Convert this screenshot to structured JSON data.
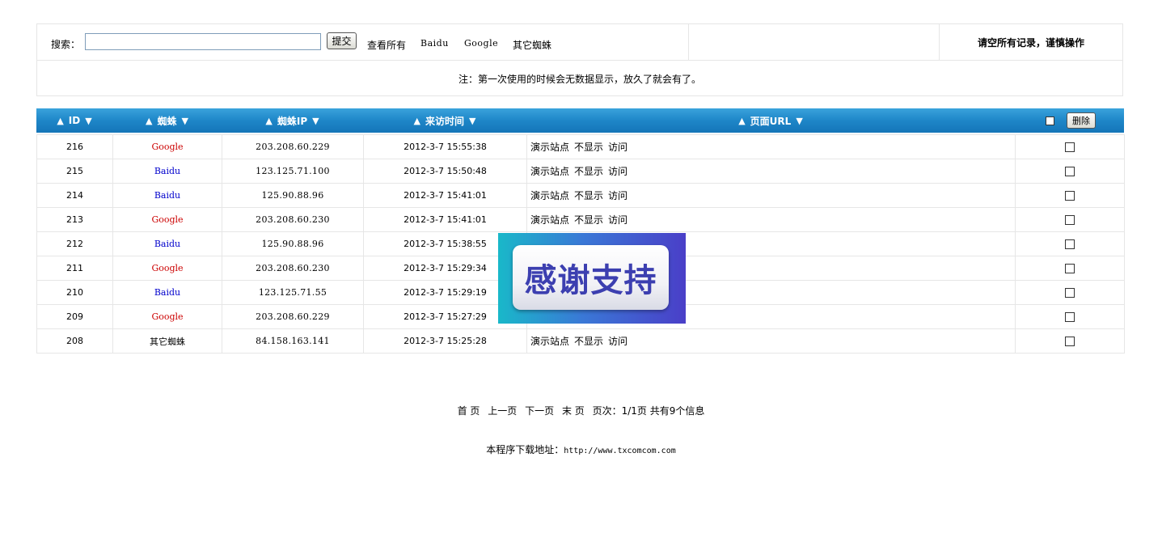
{
  "search": {
    "label": "搜索：",
    "value": "",
    "submit_label": "提交",
    "links": [
      "查看所有",
      "Baidu",
      "Google",
      "其它蜘蛛"
    ]
  },
  "clear_all_label": "请空所有记录，谨慎操作",
  "note": "注：第一次使用的时候会无数据显示，放久了就会有了。",
  "table": {
    "headers": [
      "ID",
      "蜘蛛",
      "蜘蛛IP",
      "来访时间",
      "页面URL"
    ],
    "sort_up_icon": "▲",
    "sort_down_icon": "▼",
    "delete_label": "删除",
    "rows": [
      {
        "id": "216",
        "spider": "Google",
        "ip": "203.208.60.229",
        "time": "2012-3-7 15:55:38",
        "site": "演示站点",
        "hide": "不显示",
        "visit": "访问"
      },
      {
        "id": "215",
        "spider": "Baidu",
        "ip": "123.125.71.100",
        "time": "2012-3-7 15:50:48",
        "site": "演示站点",
        "hide": "不显示",
        "visit": "访问"
      },
      {
        "id": "214",
        "spider": "Baidu",
        "ip": "125.90.88.96",
        "time": "2012-3-7 15:41:01",
        "site": "演示站点",
        "hide": "不显示",
        "visit": "访问"
      },
      {
        "id": "213",
        "spider": "Google",
        "ip": "203.208.60.230",
        "time": "2012-3-7 15:41:01",
        "site": "演示站点",
        "hide": "不显示",
        "visit": "访问"
      },
      {
        "id": "212",
        "spider": "Baidu",
        "ip": "125.90.88.96",
        "time": "2012-3-7 15:38:55",
        "site": "",
        "hide": "",
        "visit": ""
      },
      {
        "id": "211",
        "spider": "Google",
        "ip": "203.208.60.230",
        "time": "2012-3-7 15:29:34",
        "site": "",
        "hide": "",
        "visit": ""
      },
      {
        "id": "210",
        "spider": "Baidu",
        "ip": "123.125.71.55",
        "time": "2012-3-7 15:29:19",
        "site": "",
        "hide": "",
        "visit": ""
      },
      {
        "id": "209",
        "spider": "Google",
        "ip": "203.208.60.229",
        "time": "2012-3-7 15:27:29",
        "site": "",
        "hide": "",
        "visit": ""
      },
      {
        "id": "208",
        "spider": "其它蜘蛛",
        "ip": "84.158.163.141",
        "time": "2012-3-7 15:25:28",
        "site": "演示站点",
        "hide": "不显示",
        "visit": "访问"
      }
    ]
  },
  "pager": {
    "first": "首 页",
    "prev": "上一页",
    "next": "下一页",
    "last": "末 页",
    "info": "页次：1/1页 共有9个信息"
  },
  "footer": {
    "label": "本程序下载地址：",
    "url": "http://www.txcomcom.com"
  },
  "overlay": {
    "text": "感谢支持"
  }
}
